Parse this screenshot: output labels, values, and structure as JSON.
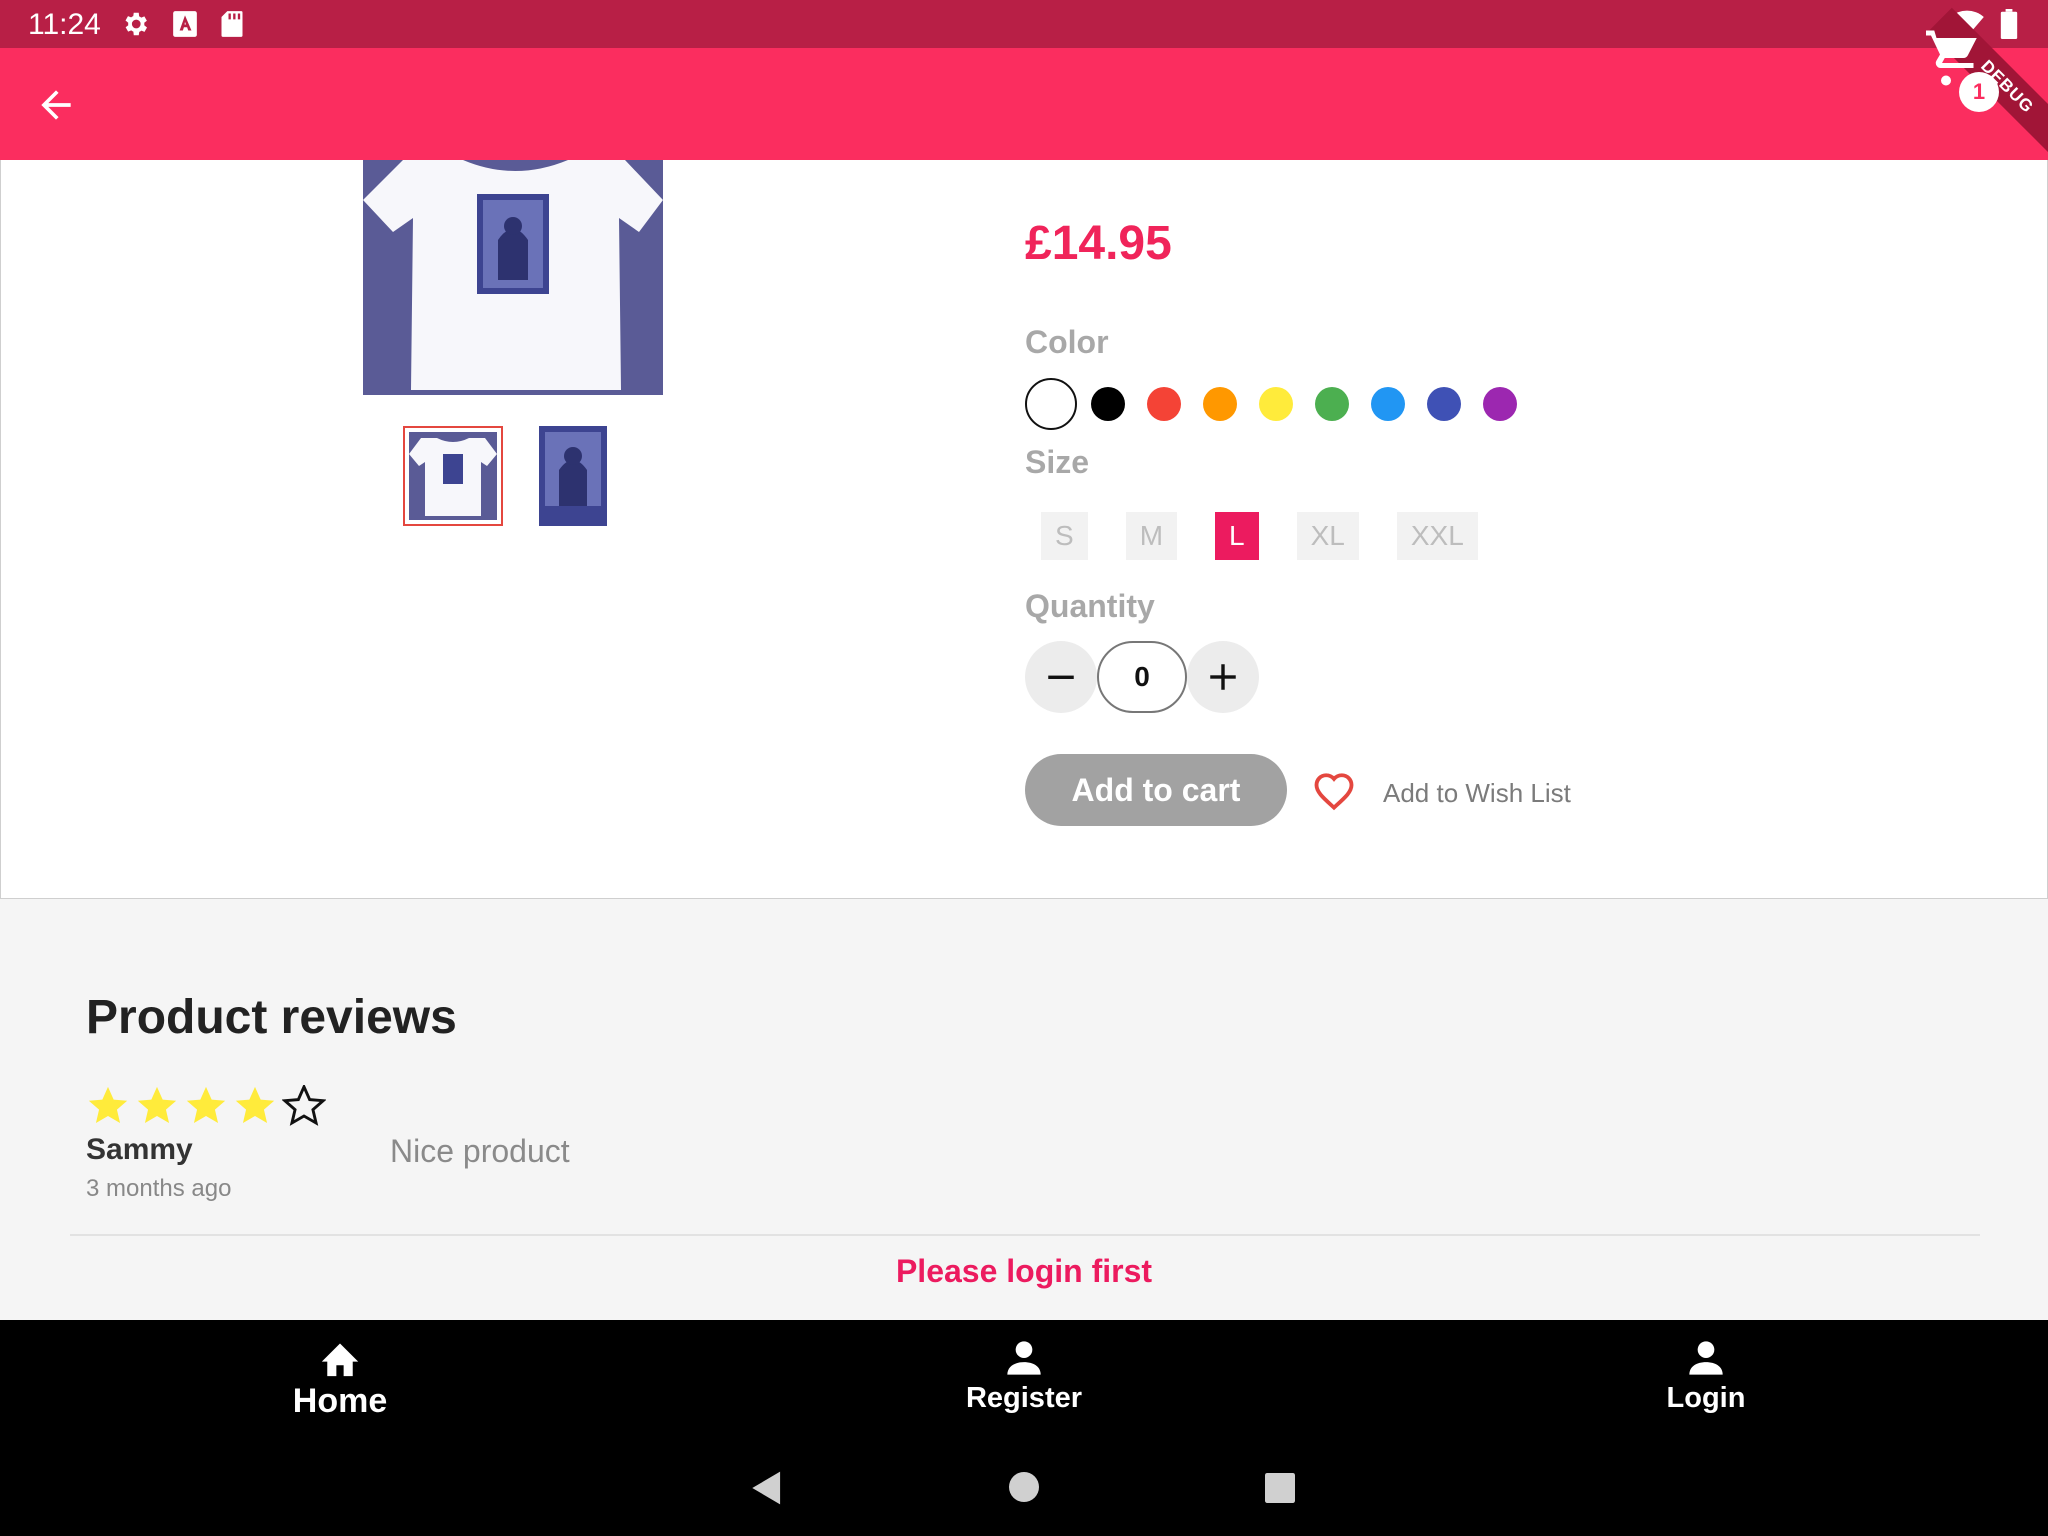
{
  "status_bar": {
    "time": "11:24",
    "left_icons": [
      "settings-icon",
      "keyboard-a-icon",
      "sd-card-icon"
    ],
    "right_icons": [
      "wifi-icon",
      "battery-icon"
    ]
  },
  "app_bar": {
    "back_icon": "arrow-back-icon",
    "cart_icon": "shopping-cart-icon",
    "cart_count": "1",
    "debug_label": "DEBUG",
    "background": "#fb2d5f"
  },
  "product": {
    "price": "£14.95",
    "color_label": "Color",
    "colors": [
      "#ffffff",
      "#000000",
      "#f44336",
      "#ff9800",
      "#ffeb3b",
      "#4caf50",
      "#2196f3",
      "#3f51b5",
      "#9c27b0"
    ],
    "selected_color": "#ffffff",
    "size_label": "Size",
    "sizes": [
      "S",
      "M",
      "L",
      "XL",
      "XXL"
    ],
    "selected_size": "L",
    "quantity_label": "Quantity",
    "quantity": "0",
    "add_to_cart": "Add to cart",
    "wishlist": "Add to Wish List"
  },
  "reviews": {
    "title": "Product reviews",
    "items": [
      {
        "rating": 4,
        "max_rating": 5,
        "author": "Sammy",
        "time": "3 months ago",
        "text": "Nice product"
      }
    ],
    "login_notice": "Please login first"
  },
  "bottom_nav": [
    {
      "label": "Home",
      "icon": "home-icon"
    },
    {
      "label": "Register",
      "icon": "person-icon"
    },
    {
      "label": "Login",
      "icon": "person-icon"
    }
  ],
  "system_nav": [
    "back-triangle-icon",
    "home-circle-icon",
    "recents-square-icon"
  ]
}
